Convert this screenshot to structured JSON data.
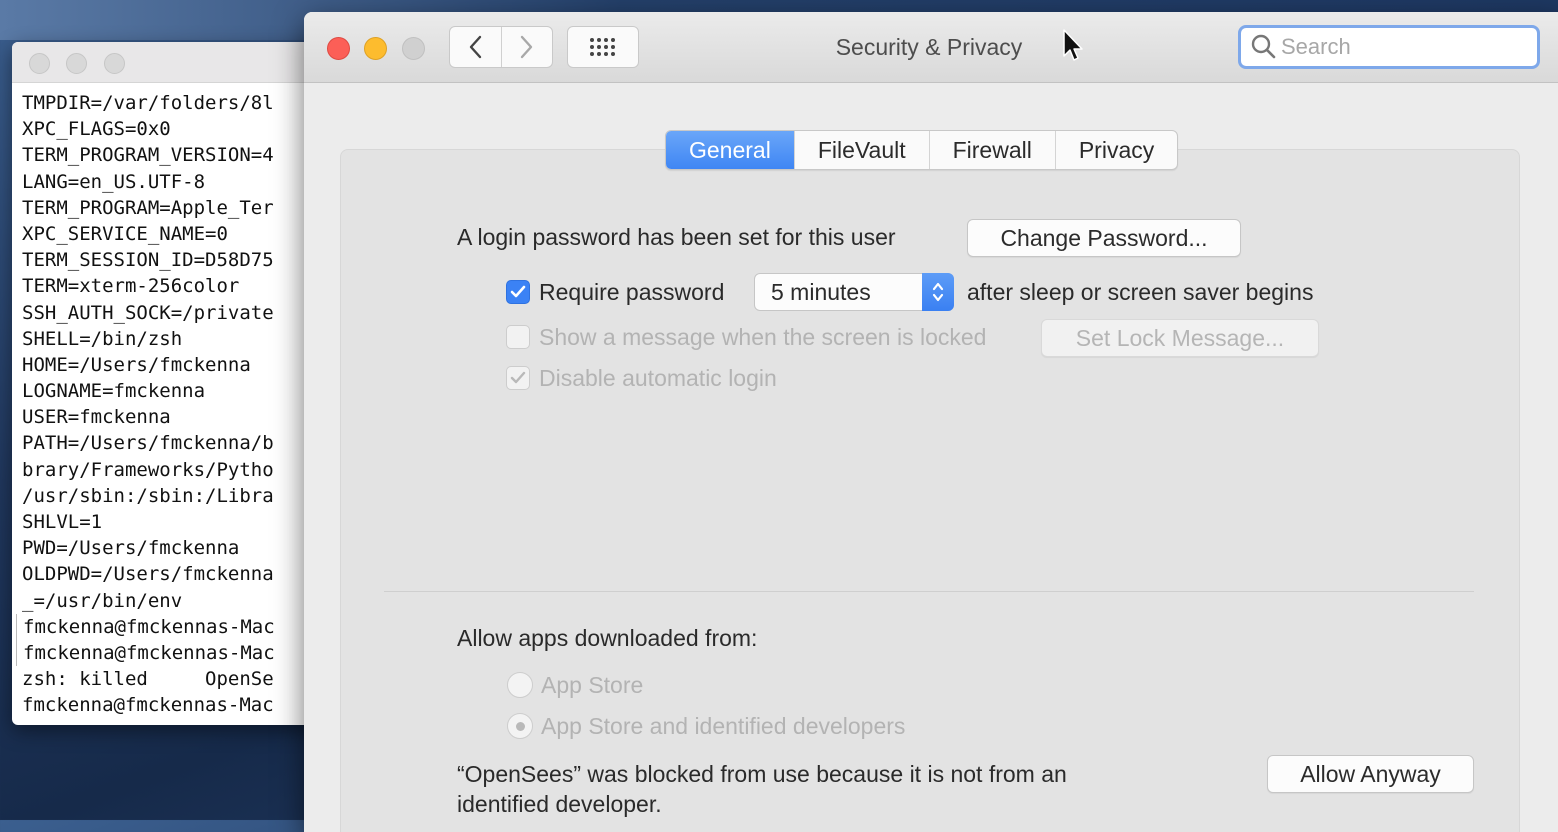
{
  "terminal": {
    "lines": [
      "TMPDIR=/var/folders/8l",
      "XPC_FLAGS=0x0",
      "TERM_PROGRAM_VERSION=4",
      "LANG=en_US.UTF-8",
      "TERM_PROGRAM=Apple_Ter",
      "XPC_SERVICE_NAME=0",
      "TERM_SESSION_ID=D58D75",
      "TERM=xterm-256color",
      "SSH_AUTH_SOCK=/private",
      "SHELL=/bin/zsh",
      "HOME=/Users/fmckenna",
      "LOGNAME=fmckenna",
      "USER=fmckenna",
      "PATH=/Users/fmckenna/b",
      "brary/Frameworks/Pytho",
      "/usr/sbin:/sbin:/Libra",
      "SHLVL=1",
      "PWD=/Users/fmckenna",
      "OLDPWD=/Users/fmckenna",
      "_=/usr/bin/env",
      "fmckenna@fmckennas-Mac",
      "fmckenna@fmckennas-Mac",
      "zsh: killed     OpenSe",
      "fmckenna@fmckennas-Mac"
    ]
  },
  "window": {
    "title": "Security & Privacy",
    "search_placeholder": "Search"
  },
  "tabs": [
    "General",
    "FileVault",
    "Firewall",
    "Privacy"
  ],
  "general": {
    "login_text": "A login password has been set for this user",
    "change_password_label": "Change Password...",
    "require_password_label": "Require password",
    "require_password_checked": true,
    "require_password_delay": "5 minutes",
    "after_sleep_text": "after sleep or screen saver begins",
    "show_message_label": "Show a message when the screen is locked",
    "show_message_checked": false,
    "set_lock_message_label": "Set Lock Message...",
    "disable_autologin_label": "Disable automatic login",
    "disable_autologin_checked": true,
    "allow_apps_label": "Allow apps downloaded from:",
    "radio_app_store": "App Store",
    "radio_identified": "App Store and identified developers",
    "selected_radio": "App Store and identified developers",
    "blocked_line1": "“OpenSees” was blocked from use because it is not from an",
    "blocked_line2": "identified developer.",
    "allow_anyway_label": "Allow Anyway"
  },
  "colors": {
    "accent": "#3b82f5",
    "close": "#fc5f57",
    "minimize": "#fdbc2e"
  }
}
